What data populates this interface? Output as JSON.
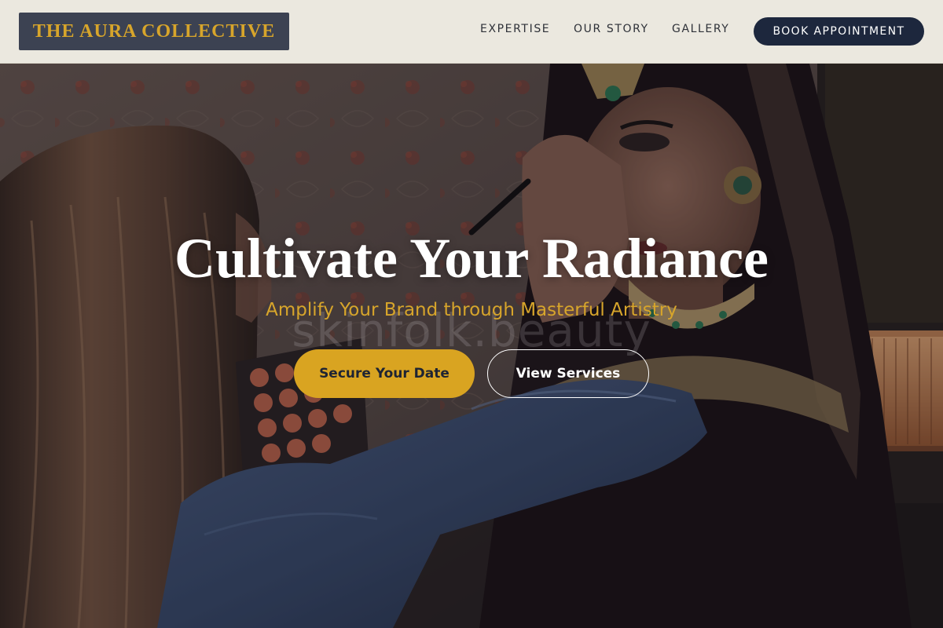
{
  "header": {
    "logo_text": "THE AURA COLLECTIVE",
    "nav": [
      {
        "label": "EXPERTISE"
      },
      {
        "label": "OUR STORY"
      },
      {
        "label": "GALLERY"
      }
    ],
    "cta_label": "BOOK APPOINTMENT"
  },
  "hero": {
    "title": "Cultivate Your Radiance",
    "subtitle": "Amplify Your Brand through Masterful Artistry",
    "watermark": "skinfolk.beauty",
    "primary_button": "Secure Your Date",
    "secondary_button": "View Services",
    "background_image": "makeup artist applying eye makeup to a bride"
  },
  "colors": {
    "header_bg": "#ebe8df",
    "logo_bg": "#3c4252",
    "gold_accent": "#d7a52b",
    "navy": "#1d273d",
    "white": "#ffffff"
  }
}
